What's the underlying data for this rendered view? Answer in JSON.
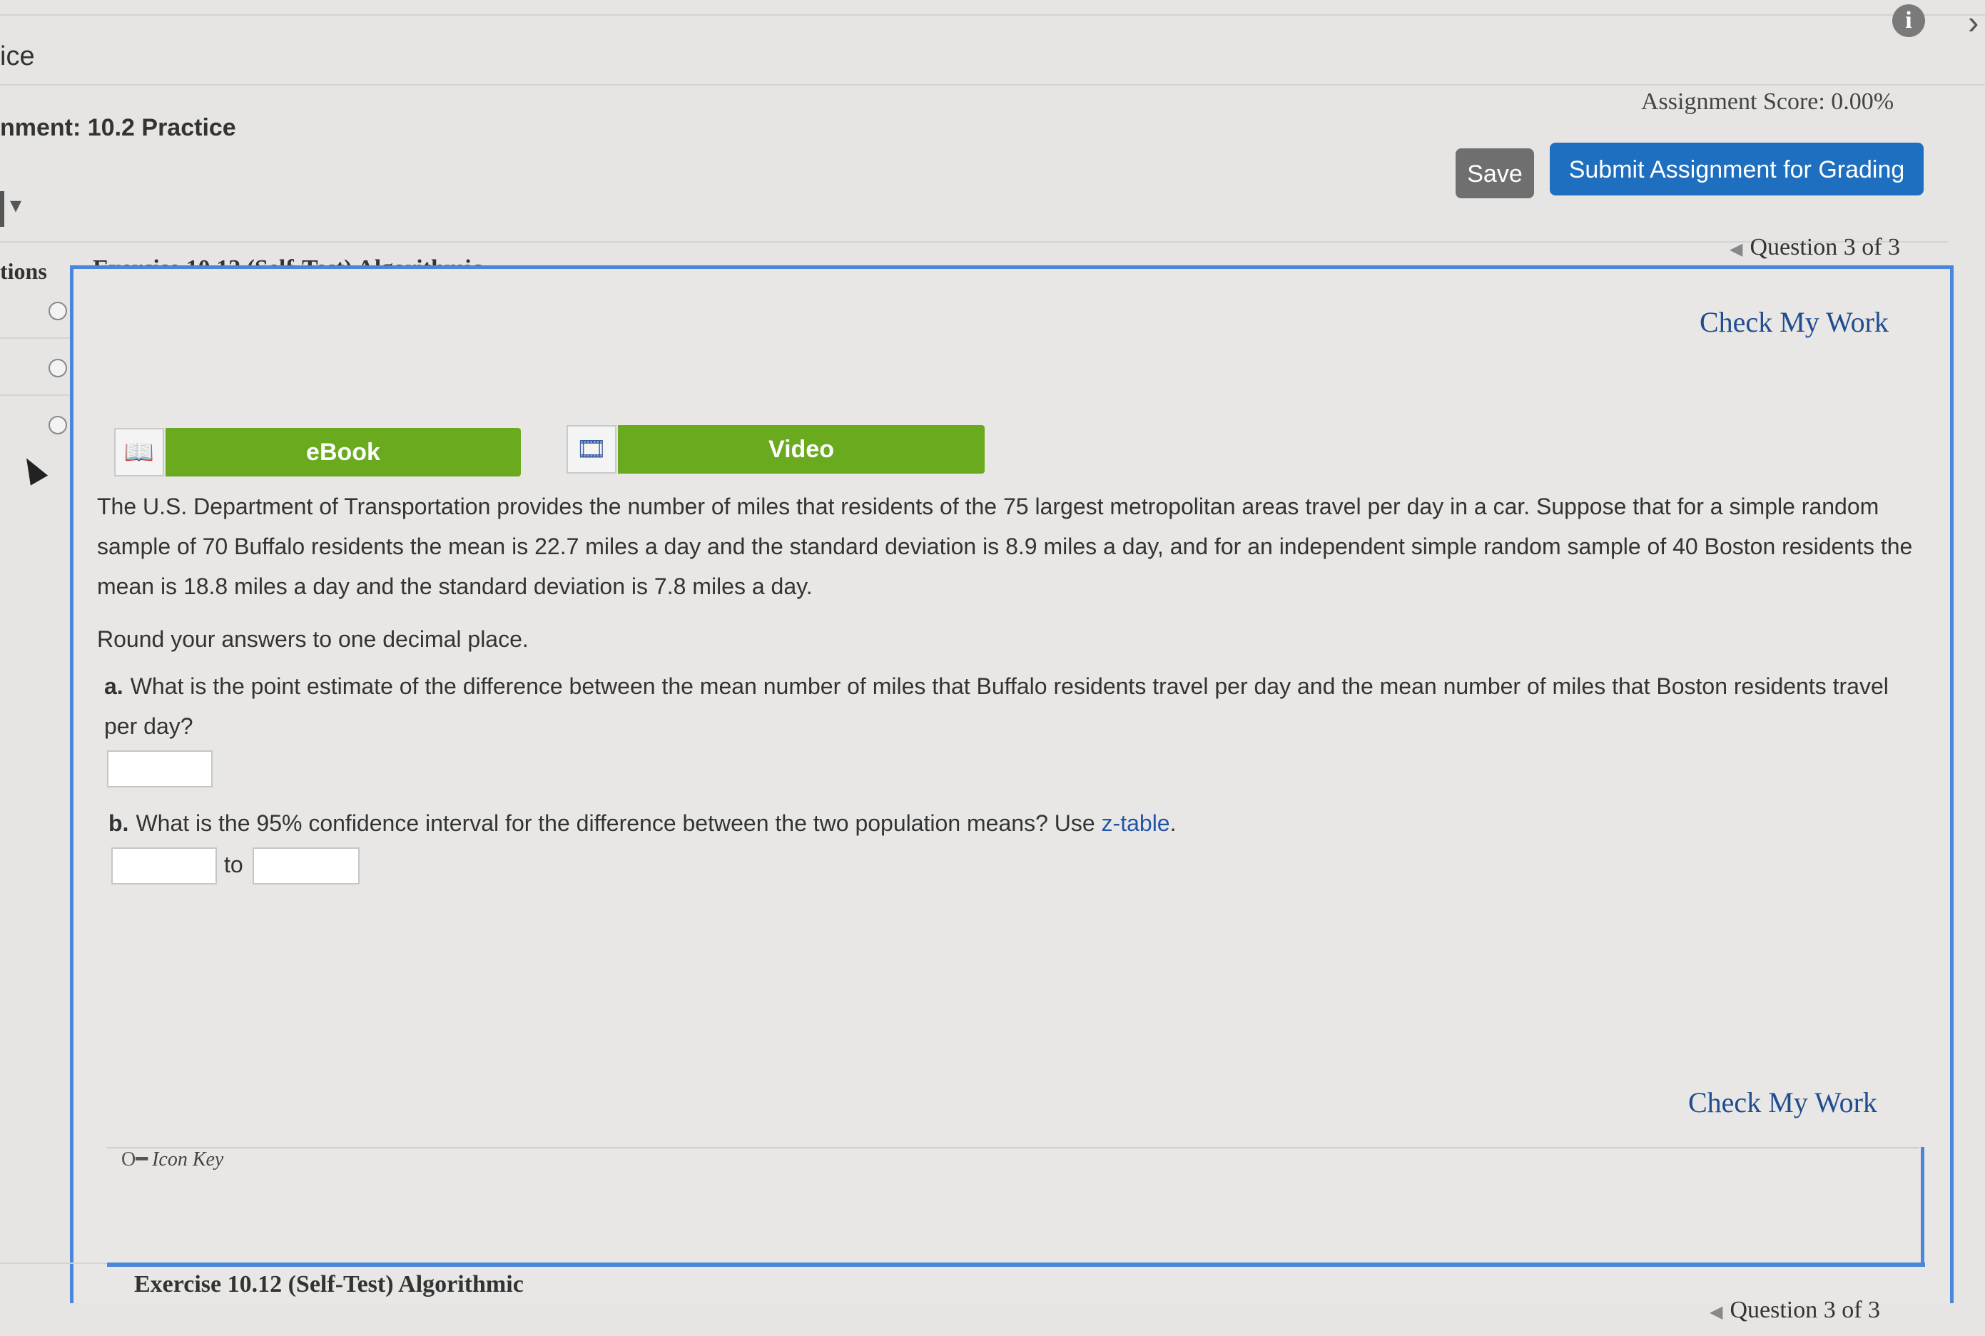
{
  "app": {
    "title": "ice"
  },
  "header": {
    "assignment_title": "nment: 10.2 Practice",
    "score": "Assignment Score: 0.00%",
    "save_label": "Save",
    "submit_label": "Submit Assignment for Grading"
  },
  "panel": {
    "left_tab": "tions",
    "exercise_title": "Exercise 10.12 (Self-Test) Algorithmic",
    "question_nav": "Question 3 of 3",
    "check_my_work": "Check My Work"
  },
  "resources": {
    "ebook": "eBook",
    "video": "Video"
  },
  "problem": {
    "intro": "The U.S. Department of Transportation provides the number of miles that residents of the 75 largest metropolitan areas travel per day in a car. Suppose that for a simple random sample of 70 Buffalo residents the mean is 22.7 miles a day and the standard deviation is 8.9 miles a day, and for an independent simple random sample of 40 Boston residents the mean is 18.8 miles a day and the standard deviation is 7.8 miles a day.",
    "rounding": "Round your answers to one decimal place.",
    "a_label": "a.",
    "a_text": "What is the point estimate of the difference between the mean number of miles that Buffalo residents travel per day and the mean number of miles that Boston residents travel per day?",
    "a_value": "",
    "b_label": "b.",
    "b_text": "What is the 95% confidence interval for the difference between the two population means? Use",
    "b_link": "z-table",
    "b_end": ".",
    "to_label": "to",
    "b_low": "",
    "b_high": ""
  },
  "footer": {
    "icon_key": "Icon Key",
    "exercise_title": "Exercise 10.12 (Self-Test) Algorithmic",
    "question_nav": "Question 3 of 3"
  }
}
